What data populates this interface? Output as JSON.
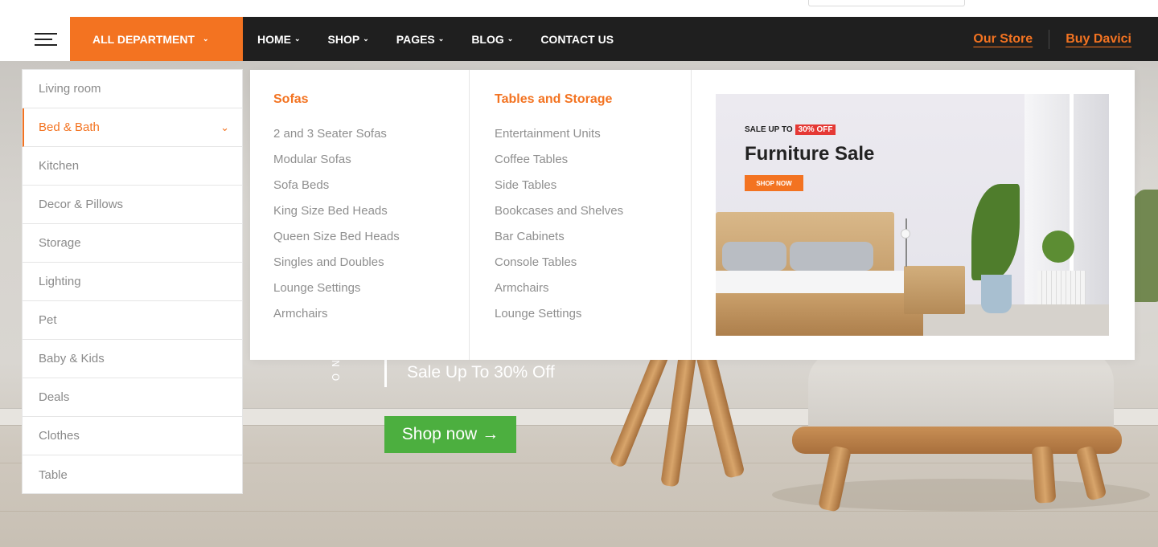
{
  "nav": {
    "departments_label": "ALL DEPARTMENT",
    "menu": [
      {
        "label": "HOME",
        "has_dropdown": true
      },
      {
        "label": "SHOP",
        "has_dropdown": true
      },
      {
        "label": "PAGES",
        "has_dropdown": true
      },
      {
        "label": "BLOG",
        "has_dropdown": true
      },
      {
        "label": "CONTACT US",
        "has_dropdown": false
      }
    ],
    "right_links": [
      "Our Store",
      "Buy Davici"
    ]
  },
  "sidebar": {
    "active_index": 1,
    "items": [
      {
        "label": "Living room"
      },
      {
        "label": "Bed & Bath"
      },
      {
        "label": "Kitchen"
      },
      {
        "label": "Decor & Pillows"
      },
      {
        "label": "Storage"
      },
      {
        "label": "Lighting"
      },
      {
        "label": "Pet"
      },
      {
        "label": "Baby & Kids"
      },
      {
        "label": "Deals"
      },
      {
        "label": "Clothes"
      },
      {
        "label": "Table"
      }
    ]
  },
  "mega_menu": {
    "columns": [
      {
        "title": "Sofas",
        "links": [
          "2 and 3 Seater Sofas",
          "Modular Sofas",
          "Sofa Beds",
          "King Size Bed Heads",
          "Queen Size Bed Heads",
          "Singles and Doubles",
          "Lounge Settings",
          "Armchairs"
        ]
      },
      {
        "title": "Tables and Storage",
        "links": [
          "Entertainment Units",
          "Coffee Tables",
          "Side Tables",
          "Bookcases and Shelves",
          "Bar Cabinets",
          "Console Tables",
          "Armchairs",
          "Lounge Settings"
        ]
      }
    ],
    "promo": {
      "sale_prefix": "SALE UP TO",
      "sale_badge": "30% OFF",
      "title": "Furniture Sale",
      "button": "SHOP NOW"
    }
  },
  "hero": {
    "vertical_text": "O N",
    "sale_text": "Sale Up To 30% Off",
    "shop_button": "Shop now",
    "shop_button_arrow": "→"
  },
  "colors": {
    "accent": "#f37321",
    "nav_bg": "#1f1f1f",
    "shop_button": "#4caf3f",
    "badge": "#e53935"
  },
  "icons": {
    "menu": "hamburger-icon",
    "dropdown": "chevron-down-icon",
    "arrow": "arrow-right-icon"
  }
}
